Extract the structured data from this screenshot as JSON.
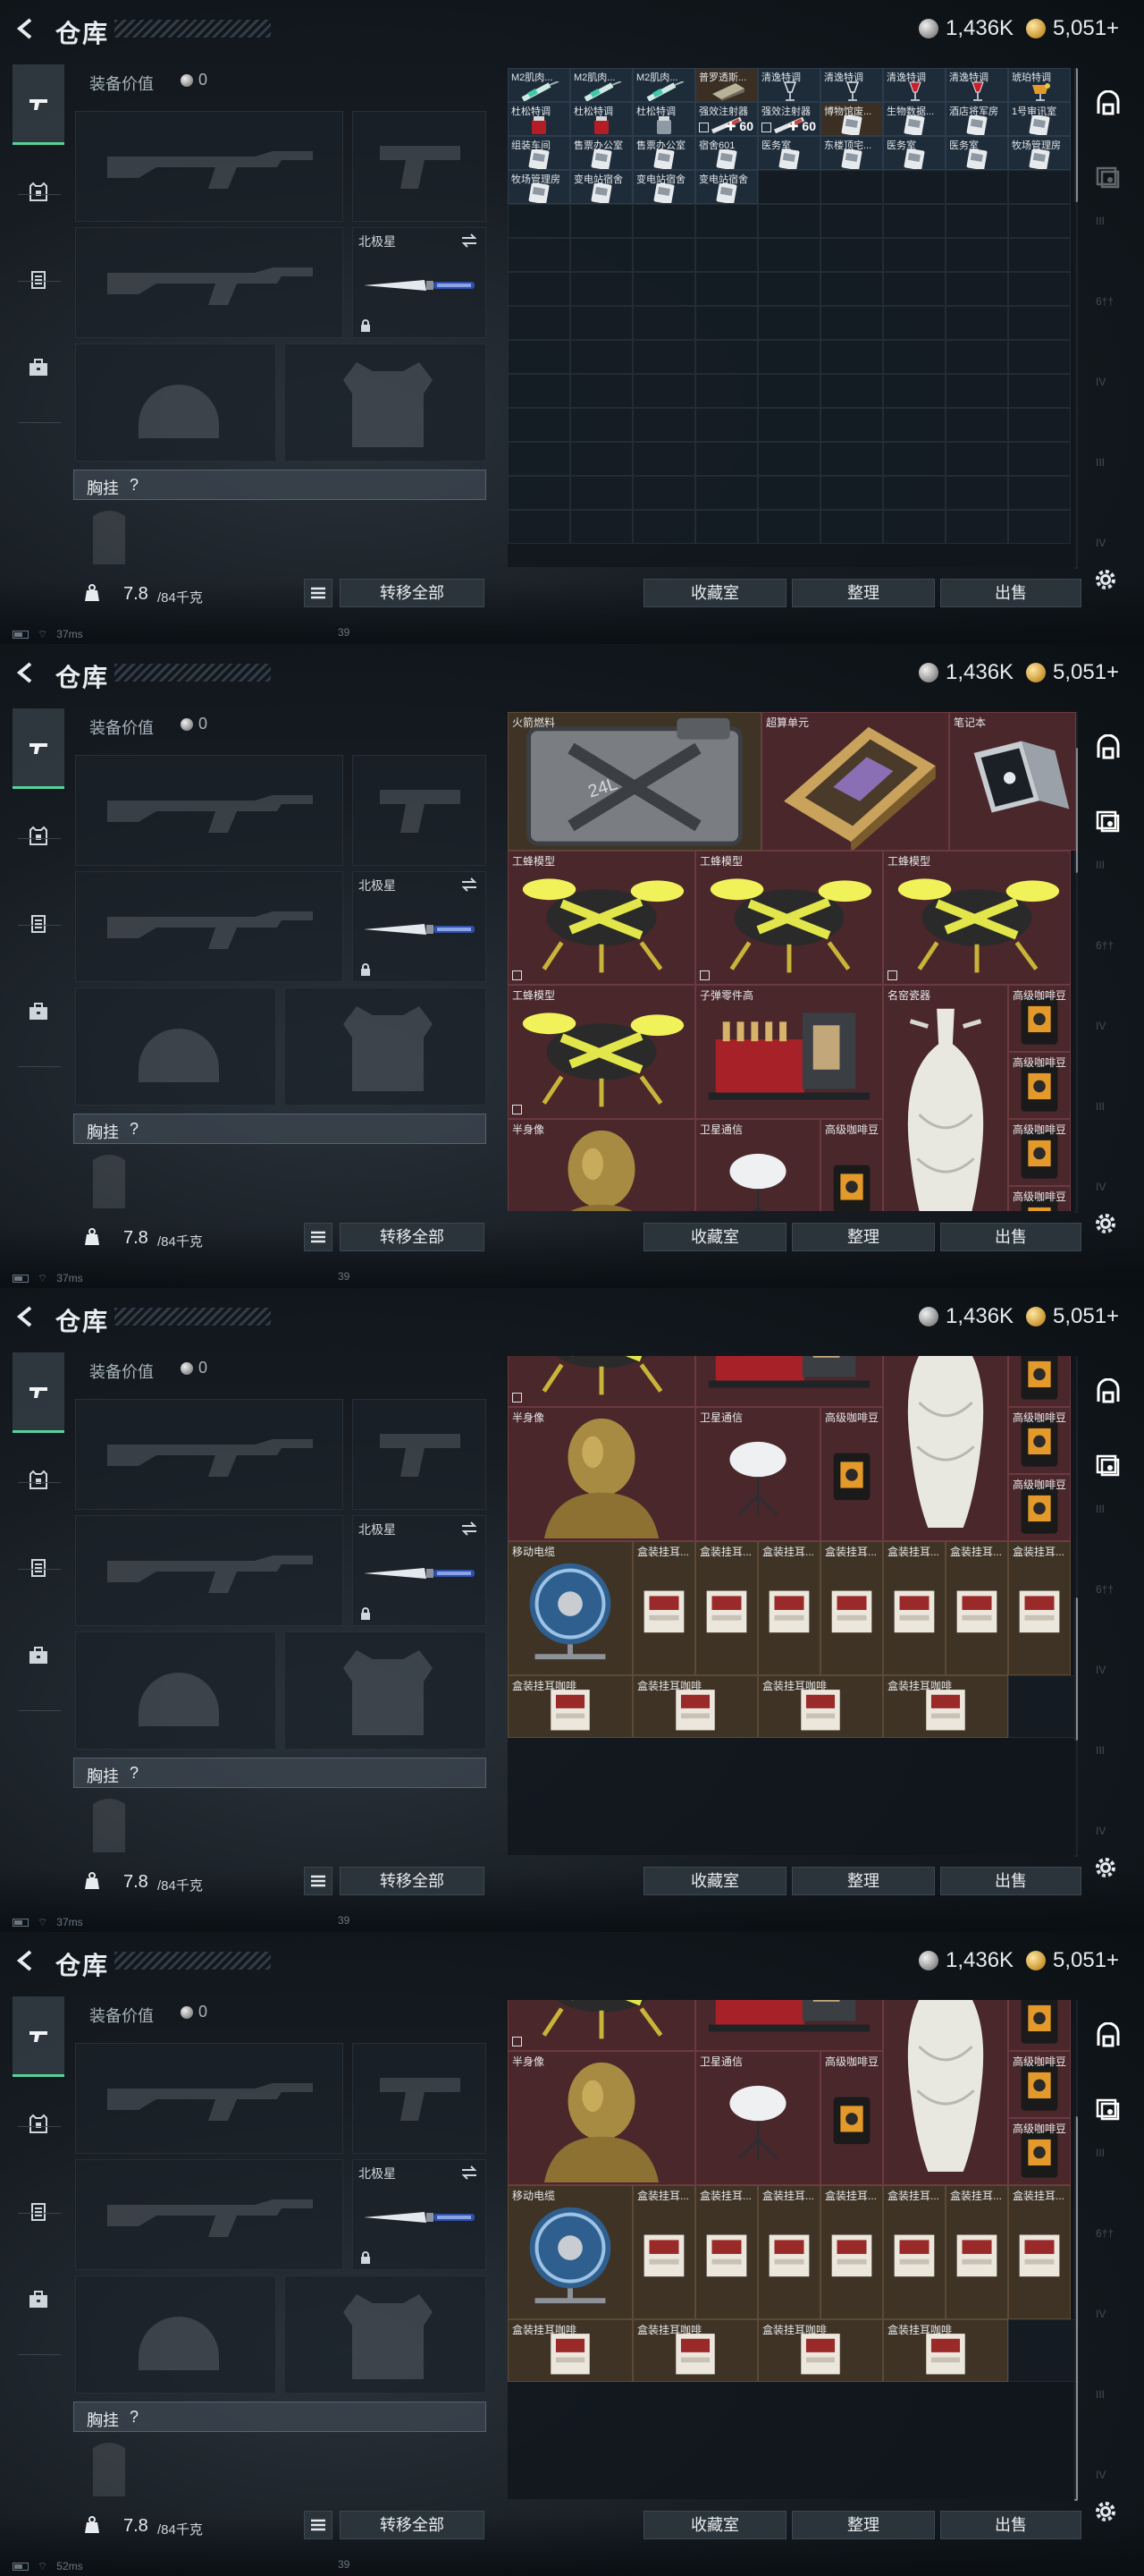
{
  "header": {
    "title": "仓库",
    "silver": "1,436K",
    "gold": "5,051+"
  },
  "equipment": {
    "value_label": "装备价值",
    "value": "0",
    "melee_name": "北极星",
    "chest_label": "胸挂",
    "chest_value": "?"
  },
  "footer": {
    "weight": "7.8",
    "capacity": "/84千克",
    "transfer_all": "转移全部",
    "collection_room": "收藏室",
    "sort": "整理",
    "sell": "出售"
  },
  "status_bar": [
    {
      "ping": "37ms",
      "counter": "39"
    },
    {
      "ping": "37ms",
      "counter": "39"
    },
    {
      "ping": "37ms",
      "counter": "39"
    },
    {
      "ping": "52ms",
      "counter": "39"
    }
  ],
  "small_grid": {
    "rows": [
      [
        {
          "label": "M2肌肉...",
          "tone": "blue",
          "icon": "syringe-icon"
        },
        {
          "label": "M2肌肉...",
          "tone": "blue",
          "icon": "syringe-icon"
        },
        {
          "label": "M2肌肉...",
          "tone": "blue",
          "icon": "syringe-icon"
        },
        {
          "label": "普罗透斯...",
          "tone": "gold",
          "icon": "brick-icon"
        },
        {
          "label": "清逸特调",
          "tone": "blue",
          "icon": "glass-icon"
        },
        {
          "label": "清逸特调",
          "tone": "blue",
          "icon": "glass-icon"
        },
        {
          "label": "清逸特调",
          "tone": "blue",
          "icon": "wine-red-icon"
        },
        {
          "label": "清逸特调",
          "tone": "blue",
          "icon": "wine-red-icon"
        },
        {
          "label": "琥珀特调",
          "tone": "blue",
          "icon": "amber-glass-icon"
        }
      ],
      [
        {
          "label": "杜松特调",
          "tone": "blue",
          "icon": "jar-red-icon"
        },
        {
          "label": "杜松特调",
          "tone": "blue",
          "icon": "jar-red-icon"
        },
        {
          "label": "杜松特调",
          "tone": "blue",
          "icon": "jar-icon"
        },
        {
          "label": "强效注射器",
          "tone": "blue",
          "icon": "injector-icon",
          "count": "60"
        },
        {
          "label": "强效注射器",
          "tone": "blue",
          "icon": "injector-icon",
          "count": "60"
        },
        {
          "label": "博物馆废...",
          "tone": "gold",
          "icon": "card-icon"
        },
        {
          "label": "生物数据...",
          "tone": "blue",
          "icon": "card-icon"
        },
        {
          "label": "酒店将军房",
          "tone": "blue",
          "icon": "card-icon"
        },
        {
          "label": "1号审讯室",
          "tone": "blue",
          "icon": "card-icon"
        }
      ],
      [
        {
          "label": "组装车间",
          "tone": "blue",
          "icon": "card-icon"
        },
        {
          "label": "售票办公室",
          "tone": "blue",
          "icon": "card-icon"
        },
        {
          "label": "售票办公室",
          "tone": "blue",
          "icon": "card-icon"
        },
        {
          "label": "宿舍601",
          "tone": "blue",
          "icon": "card-icon"
        },
        {
          "label": "医务室",
          "tone": "blue",
          "icon": "card-icon"
        },
        {
          "label": "东楼顶宅...",
          "tone": "blue",
          "icon": "card-icon"
        },
        {
          "label": "医务室",
          "tone": "blue",
          "icon": "card-icon"
        },
        {
          "label": "医务室",
          "tone": "blue",
          "icon": "card-icon"
        },
        {
          "label": "牧场管理房",
          "tone": "blue",
          "icon": "card-icon"
        }
      ],
      [
        {
          "label": "牧场管理房",
          "tone": "blue",
          "icon": "card-icon"
        },
        {
          "label": "变电站宿舍",
          "tone": "blue",
          "icon": "card-icon"
        },
        {
          "label": "变电站宿舍",
          "tone": "blue",
          "icon": "card-icon"
        },
        {
          "label": "变电站宿舍",
          "tone": "blue",
          "icon": "card-icon"
        }
      ]
    ]
  },
  "items": {
    "fuel": "火箭燃料",
    "supercomputer": "超算单元",
    "laptop": "笔记本",
    "drone": "工蜂模型",
    "ammo_parts": "子弹零件高",
    "vase": "名窑瓷器",
    "coffee": "高级咖啡豆",
    "bust": "半身像",
    "satellite": "卫星通信",
    "power_reel": "移动电缆",
    "earphones": "盒装挂耳...",
    "earphones_full": "盒装挂耳咖啡"
  }
}
